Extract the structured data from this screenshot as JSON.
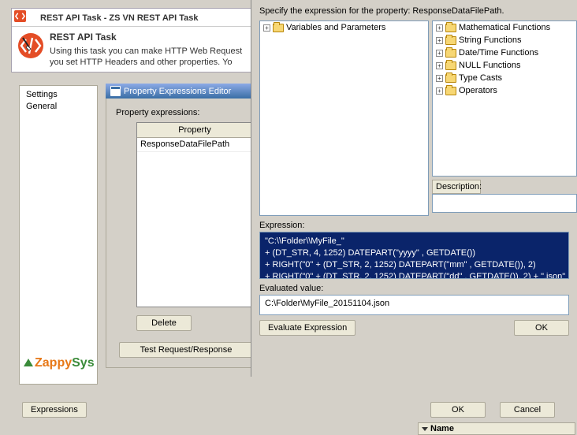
{
  "task": {
    "title_bar": "REST API Task - ZS VN REST API Task",
    "heading": "REST API Task",
    "desc": "Using this task you can make HTTP Web Request you set HTTP Headers and other properties. Yo"
  },
  "left_nav": {
    "item1": "Settings",
    "item2": "General"
  },
  "prop_editor": {
    "window_title": "Property Expressions Editor",
    "label": "Property expressions:",
    "col_property": "Property",
    "row1": "ResponseDataFilePath",
    "delete": "Delete",
    "test_btn": "Test Request/Response"
  },
  "expr_btn": "Expressions",
  "builder": {
    "instruction": "Specify the expression for the property: ResponseDataFilePath.",
    "left_tree": {
      "item1": "Variables and Parameters"
    },
    "right_tree": {
      "item1": "Mathematical Functions",
      "item2": "String Functions",
      "item3": "Date/Time Functions",
      "item4": "NULL Functions",
      "item5": "Type Casts",
      "item6": "Operators"
    },
    "description_label": "Description:",
    "expression_label": "Expression:",
    "expression_text": "\"C:\\\\Folder\\\\MyFile_\"\n+ (DT_STR, 4, 1252) DATEPART(\"yyyy\" , GETDATE())\n+ RIGHT(\"0\" + (DT_STR, 2, 1252) DATEPART(\"mm\" , GETDATE()), 2)\n+ RIGHT(\"0\" + (DT_STR, 2, 1252) DATEPART(\"dd\" , GETDATE()), 2) + \".json\"",
    "evaluated_label": "Evaluated value:",
    "evaluated_text": "C:\\Folder\\MyFile_20151104.json",
    "evaluate_btn": "Evaluate Expression",
    "ok_btn": "OK"
  },
  "dialog_buttons": {
    "ok": "OK",
    "cancel": "Cancel"
  },
  "name_col": "Name",
  "logo": {
    "part1": "Zappy",
    "part2": "Sys"
  }
}
